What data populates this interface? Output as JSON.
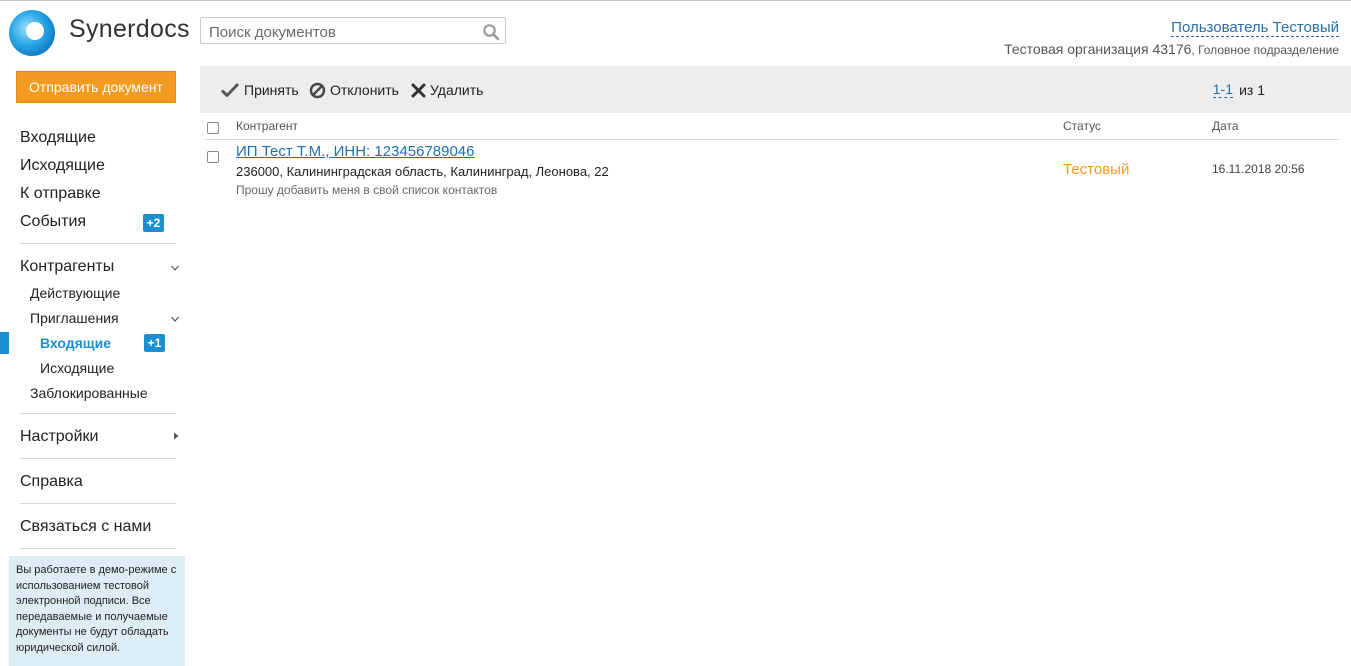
{
  "header": {
    "logo_text": "Synerdocs",
    "search_placeholder": "Поиск документов",
    "user_name": "Пользователь Тестовый",
    "org_name": "Тестовая организация 43176",
    "org_division": ", Головное подразделение"
  },
  "sidebar": {
    "send_button": "Отправить документ",
    "items": {
      "incoming": "Входящие",
      "outgoing": "Исходящие",
      "to_send": "К отправке",
      "events": "События",
      "events_badge": "+2",
      "contractors": "Контрагенты",
      "active": "Действующие",
      "invitations": "Приглашения",
      "inv_incoming": "Входящие",
      "inv_incoming_badge": "+1",
      "inv_outgoing": "Исходящие",
      "blocked": "Заблокированные",
      "settings": "Настройки",
      "help": "Справка",
      "contact": "Связаться с нами"
    },
    "demo_note": "Вы работаете в демо-режиме с использованием тестовой электронной подписи. Все передаваемые и получаемые документы не будут обладать юридической силой."
  },
  "toolbar": {
    "accept": "Принять",
    "decline": "Отклонить",
    "delete": "Удалить",
    "pager_range": "1-1",
    "pager_of": "из 1"
  },
  "table": {
    "columns": {
      "contractor": "Контрагент",
      "status": "Статус",
      "date": "Дата"
    },
    "rows": [
      {
        "name": "ИП Тест Т.М., ИНН: 123456789046",
        "address": "236000, Калининградская область, Калининград, Леонова, 22",
        "message": "Прошу добавить меня в свой список контактов",
        "status": "Тестовый",
        "date": "16.11.2018 20:56"
      }
    ]
  },
  "colors": {
    "accent": "#1c8fd0",
    "send_button": "#f39b21",
    "status_test": "#f39b21",
    "toolbar_bg": "#ededed",
    "demo_note_bg": "#dcedf6"
  }
}
